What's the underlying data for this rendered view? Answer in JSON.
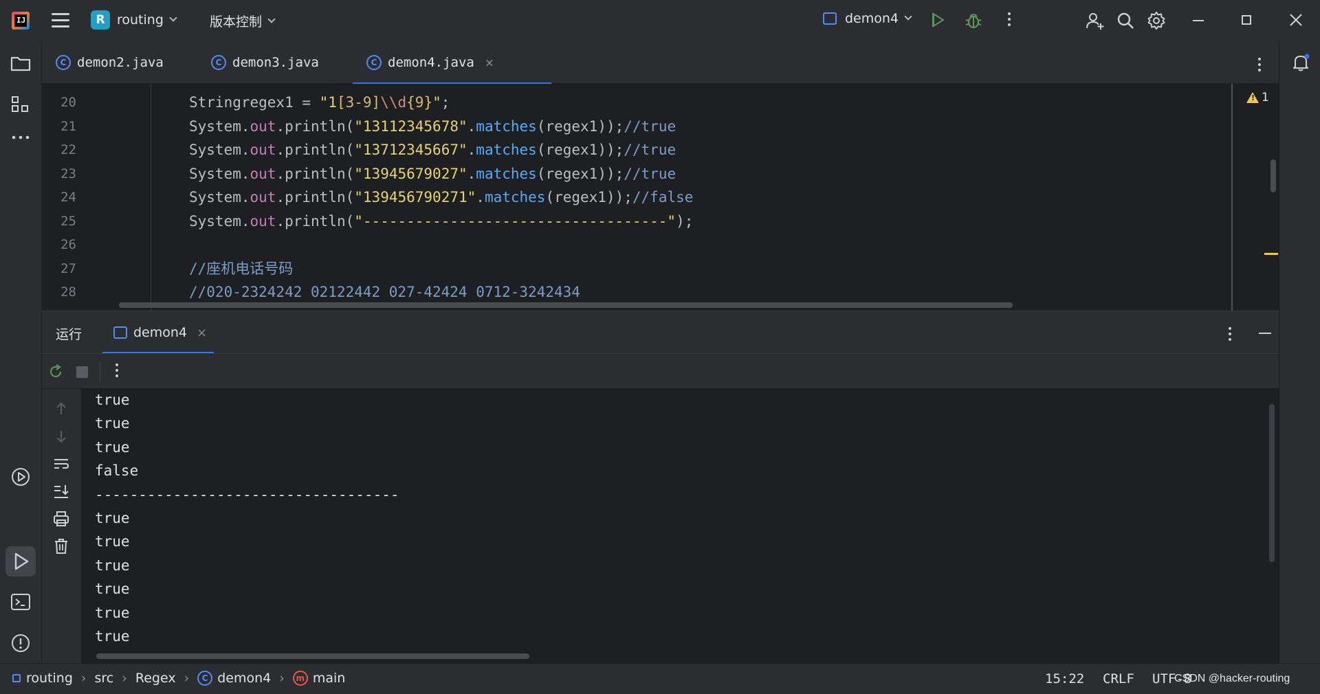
{
  "titlebar": {
    "project_badge": "R",
    "project_name": "routing",
    "vcs_label": "版本控制",
    "run_config": "demon4"
  },
  "tabs": [
    {
      "label": "demon2.java"
    },
    {
      "label": "demon3.java"
    },
    {
      "label": "demon4.java",
      "active": true
    }
  ],
  "editor": {
    "warning_count": "1",
    "lines": [
      {
        "num": "20",
        "segments": [
          [
            "kw-type",
            "String"
          ],
          [
            "",
            "regex1 = "
          ],
          [
            "str",
            "\"1"
          ],
          [
            "brk",
            "["
          ],
          [
            "rx",
            "3-9"
          ],
          [
            "brk",
            "]"
          ],
          [
            "rxmeta",
            "\\\\d"
          ],
          [
            "brk",
            "{"
          ],
          [
            "rx",
            "9"
          ],
          [
            "brk",
            "}"
          ],
          [
            "str",
            "\""
          ],
          [
            "",
            ";"
          ]
        ]
      },
      {
        "num": "21",
        "segments": [
          [
            "",
            "System."
          ],
          [
            "field",
            "out"
          ],
          [
            "",
            "."
          ],
          [
            "",
            "println("
          ],
          [
            "str",
            "\"13112345678\""
          ],
          [
            "",
            "."
          ],
          [
            "method",
            "matches"
          ],
          [
            "",
            "(regex1));"
          ],
          [
            "cmt",
            "//true"
          ]
        ]
      },
      {
        "num": "22",
        "segments": [
          [
            "",
            "System."
          ],
          [
            "field",
            "out"
          ],
          [
            "",
            "."
          ],
          [
            "",
            "println("
          ],
          [
            "str",
            "\"13712345667\""
          ],
          [
            "",
            "."
          ],
          [
            "method",
            "matches"
          ],
          [
            "",
            "(regex1));"
          ],
          [
            "cmt",
            "//true"
          ]
        ]
      },
      {
        "num": "23",
        "segments": [
          [
            "",
            "System."
          ],
          [
            "field",
            "out"
          ],
          [
            "",
            "."
          ],
          [
            "",
            "println("
          ],
          [
            "str",
            "\"13945679027\""
          ],
          [
            "",
            "."
          ],
          [
            "method",
            "matches"
          ],
          [
            "",
            "(regex1));"
          ],
          [
            "cmt",
            "//true"
          ]
        ]
      },
      {
        "num": "24",
        "segments": [
          [
            "",
            "System."
          ],
          [
            "field",
            "out"
          ],
          [
            "",
            "."
          ],
          [
            "",
            "println("
          ],
          [
            "str",
            "\"139456790271\""
          ],
          [
            "",
            "."
          ],
          [
            "method",
            "matches"
          ],
          [
            "",
            "(regex1));"
          ],
          [
            "cmt",
            "//false"
          ]
        ]
      },
      {
        "num": "25",
        "segments": [
          [
            "",
            "System."
          ],
          [
            "field",
            "out"
          ],
          [
            "",
            "."
          ],
          [
            "",
            "println("
          ],
          [
            "str",
            "\"-----------------------------------\""
          ],
          [
            "",
            ");"
          ]
        ]
      },
      {
        "num": "26",
        "segments": []
      },
      {
        "num": "27",
        "segments": [
          [
            "cmt",
            "//座机电话号码"
          ]
        ]
      },
      {
        "num": "28",
        "segments": [
          [
            "cmt",
            "//020-2324242 02122442 027-42424 0712-3242434"
          ]
        ]
      }
    ]
  },
  "run": {
    "title": "运行",
    "tab_label": "demon4",
    "output": [
      "true",
      "true",
      "true",
      "false",
      "-----------------------------------",
      "true",
      "true",
      "true",
      "true",
      "true",
      "true"
    ]
  },
  "statusbar": {
    "breadcrumbs": [
      "routing",
      "src",
      "Regex",
      "demon4",
      "main"
    ],
    "position": "15:22",
    "line_sep": "CRLF",
    "encoding": "UTF-8",
    "watermark": "CSDN @hacker-routing"
  }
}
